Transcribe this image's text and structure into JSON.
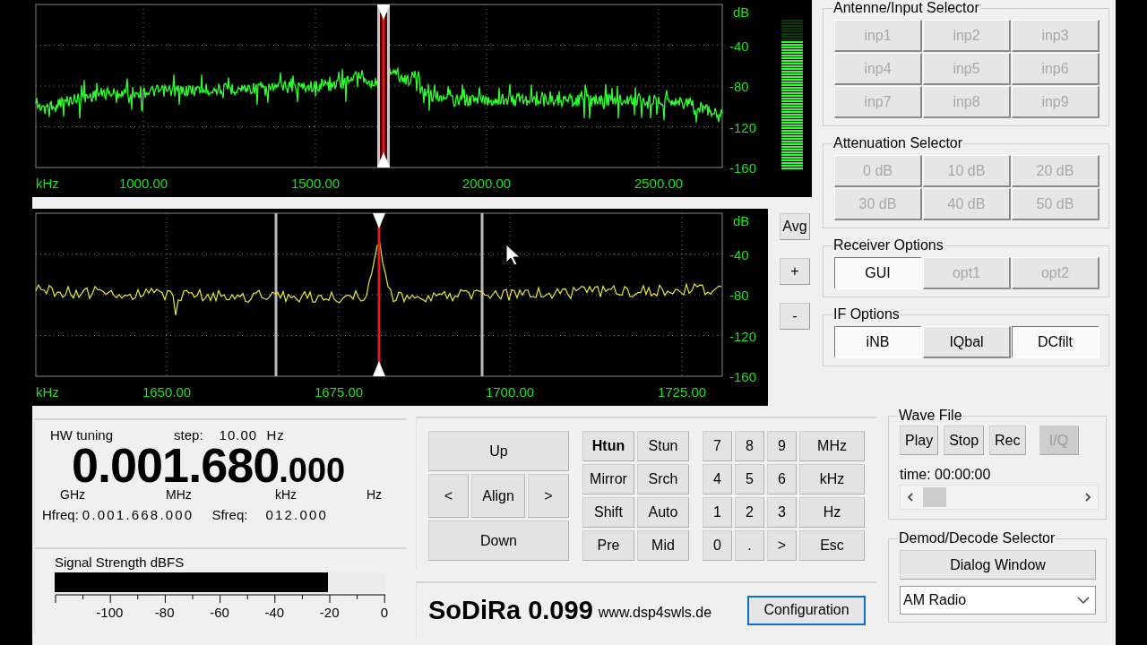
{
  "spectrum": {
    "y_unit": "dB",
    "y_labels": [
      "-40",
      "-80",
      "-120",
      "-160"
    ],
    "x_unit": "kHz",
    "x_labels": [
      "1000.00",
      "1500.00",
      "2000.00",
      "2500.00"
    ],
    "level_meter": {
      "level": 0.86
    }
  },
  "zoom_spectrum": {
    "y_unit": "dB",
    "y_labels": [
      "-40",
      "-80",
      "-120",
      "-160"
    ],
    "x_unit": "kHz",
    "x_labels": [
      "1650.00",
      "1675.00",
      "1700.00",
      "1725.00"
    ],
    "buttons": [
      "Avg",
      "+",
      "-"
    ]
  },
  "input_selector": {
    "title": "Antenne/Input Selector",
    "buttons": [
      {
        "label": "inp1",
        "disabled": true
      },
      {
        "label": "inp2",
        "disabled": true
      },
      {
        "label": "inp3",
        "disabled": true
      },
      {
        "label": "inp4",
        "disabled": true
      },
      {
        "label": "inp5",
        "disabled": true
      },
      {
        "label": "inp6",
        "disabled": true
      },
      {
        "label": "inp7",
        "disabled": true
      },
      {
        "label": "inp8",
        "disabled": true
      },
      {
        "label": "inp9",
        "disabled": true
      }
    ]
  },
  "attenuation_selector": {
    "title": "Attenuation Selector",
    "buttons": [
      {
        "label": "0 dB",
        "disabled": true
      },
      {
        "label": "10 dB",
        "disabled": true
      },
      {
        "label": "20 dB",
        "disabled": true
      },
      {
        "label": "30 dB",
        "disabled": true
      },
      {
        "label": "40 dB",
        "disabled": true
      },
      {
        "label": "50 dB",
        "disabled": true
      }
    ]
  },
  "receiver_options": {
    "title": "Receiver Options",
    "buttons": [
      {
        "label": "GUI",
        "selected": true,
        "disabled": false
      },
      {
        "label": "opt1",
        "selected": false,
        "disabled": true
      },
      {
        "label": "opt2",
        "selected": false,
        "disabled": true
      }
    ]
  },
  "if_options": {
    "title": "IF Options",
    "buttons": [
      {
        "label": "iNB",
        "selected": true
      },
      {
        "label": "IQbal",
        "selected": false
      },
      {
        "label": "DCfilt",
        "selected": true
      }
    ]
  },
  "tuning": {
    "mode": "HW tuning",
    "step_label": "step:",
    "step_value": "10.00  Hz",
    "frequency_main": "0.001.680",
    "frequency_fine": ".000",
    "units": [
      "GHz",
      "MHz",
      "kHz",
      "Hz"
    ],
    "hfreq_label": "Hfreq:",
    "hfreq_value": "0.001.668.000",
    "sfreq_label": "Sfreq:",
    "sfreq_value": "012.000"
  },
  "signal_strength": {
    "title": "Signal Strength dBFS",
    "level": 0.83,
    "scale": [
      "-100",
      "-80",
      "-60",
      "-40",
      "-20",
      "0"
    ]
  },
  "navigation": {
    "up": "Up",
    "left": "<",
    "align": "Align",
    "right": ">",
    "down": "Down"
  },
  "function_keys": [
    {
      "label": "Htun",
      "selected": true
    },
    {
      "label": "Stun",
      "selected": false
    },
    {
      "label": "Mirror",
      "selected": false
    },
    {
      "label": "Srch",
      "selected": false
    },
    {
      "label": "Shift",
      "selected": false
    },
    {
      "label": "Auto",
      "selected": false
    },
    {
      "label": "Pre",
      "selected": false
    },
    {
      "label": "Mid",
      "selected": false
    }
  ],
  "keypad": [
    "7",
    "8",
    "9",
    "MHz",
    "4",
    "5",
    "6",
    "kHz",
    "1",
    "2",
    "3",
    "Hz",
    "0",
    ".",
    ">",
    "Esc"
  ],
  "brand": {
    "name": "SoDiRa 0.099",
    "url": "www.dsp4swls.de"
  },
  "configuration_button": {
    "label": "Configuration",
    "focused": true
  },
  "wave_file": {
    "title": "Wave File",
    "buttons": [
      {
        "label": "Play",
        "disabled": false
      },
      {
        "label": "Stop",
        "disabled": false
      },
      {
        "label": "Rec",
        "disabled": false
      },
      {
        "label": "I/Q",
        "disabled": true
      }
    ],
    "time": "time: 00:00:00"
  },
  "demod_selector": {
    "title": "Demod/Decode Selector",
    "button": "Dialog Window",
    "mode": "AM Radio"
  }
}
